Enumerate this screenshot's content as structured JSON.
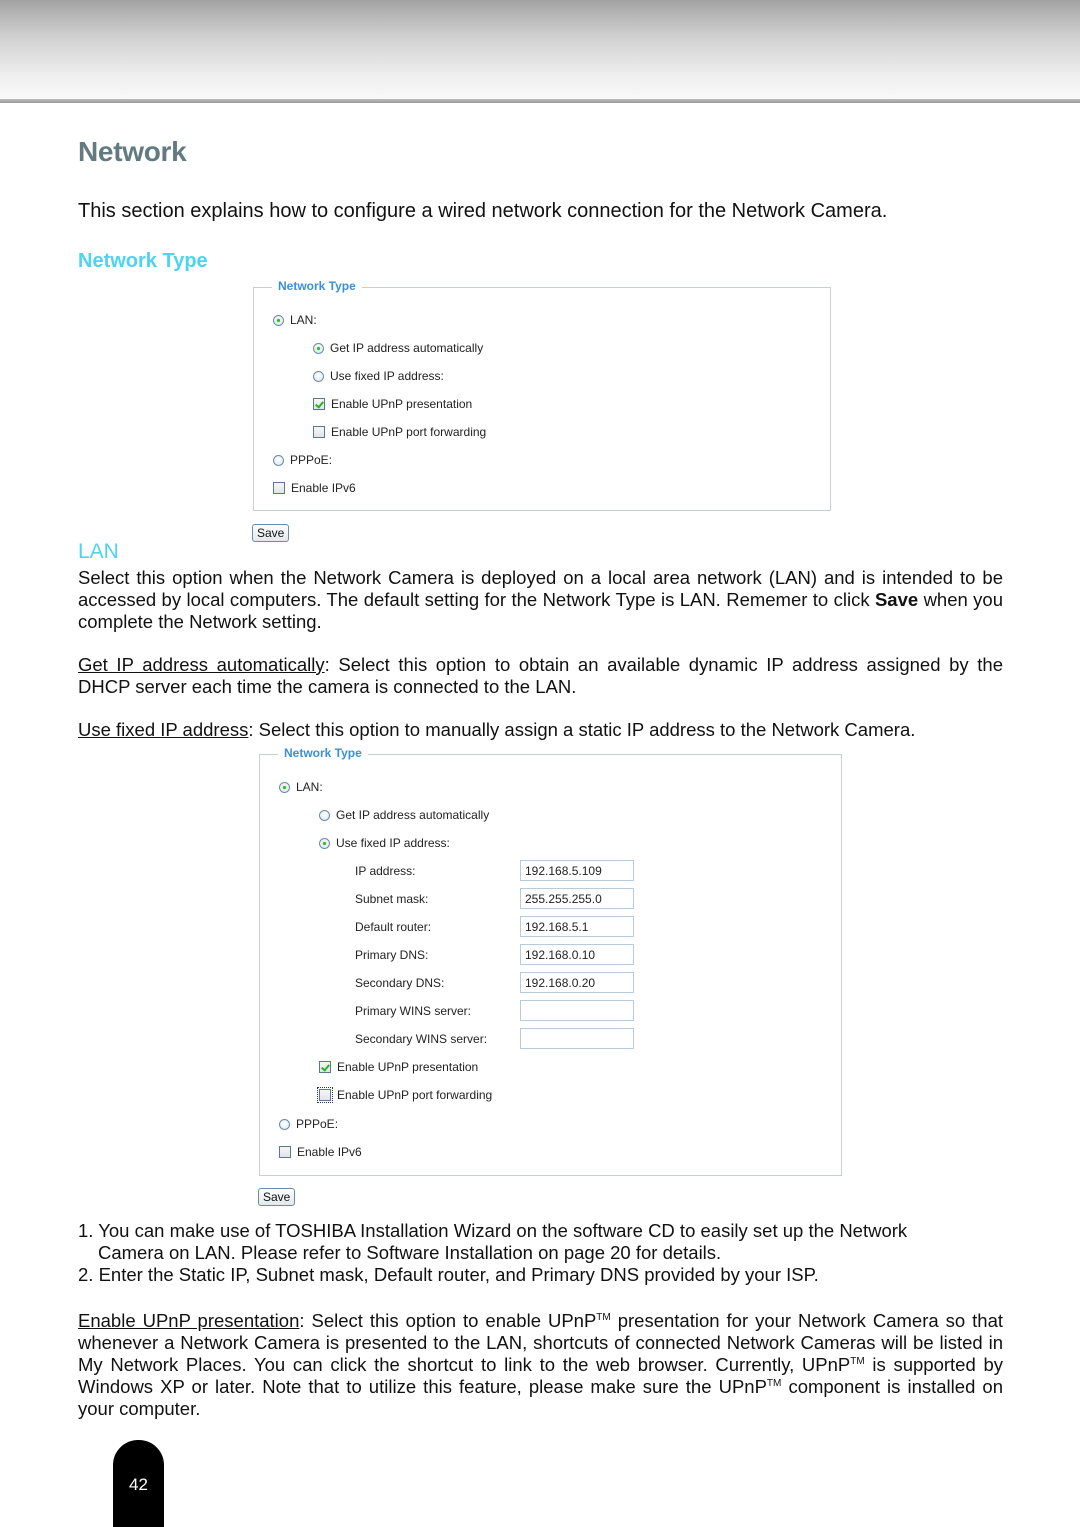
{
  "page": {
    "title": "Network",
    "intro": "This section explains how to configure a wired network connection for the Network Camera.",
    "subheading": "Network Type",
    "lan_heading": "LAN",
    "page_number": "42"
  },
  "panel1": {
    "legend": "Network Type",
    "lan_label": "LAN:",
    "lan_selected": true,
    "get_ip_auto_label": "Get IP address automatically",
    "get_ip_auto_selected": true,
    "use_fixed_ip_label": "Use fixed IP address:",
    "use_fixed_ip_selected": false,
    "upnp_presentation_label": "Enable UPnP presentation",
    "upnp_presentation_checked": true,
    "upnp_port_forwarding_label": "Enable UPnP port forwarding",
    "upnp_port_forwarding_checked": false,
    "pppoe_label": "PPPoE:",
    "pppoe_selected": false,
    "ipv6_label": "Enable IPv6",
    "ipv6_checked": false,
    "save_label": "Save"
  },
  "lan_section": {
    "para1_a": "Select this option when the Network Camera is deployed on a local area network (LAN) and is intended to be accessed by local computers. The default setting for the Network Type is LAN. Rememer to click ",
    "para1_bold": "Save",
    "para1_b": " when you complete the Network setting.",
    "get_ip_term": "Get IP address automatically",
    "get_ip_desc": ": Select this option to obtain an available dynamic IP address assigned by the DHCP server each time the camera is connected to the LAN.",
    "fixed_ip_term": "Use fixed IP address",
    "fixed_ip_desc": ": Select this option to manually assign a static IP address to the Network Camera."
  },
  "panel2": {
    "legend": "Network Type",
    "lan_label": "LAN:",
    "lan_selected": true,
    "get_ip_auto_label": "Get IP address automatically",
    "get_ip_auto_selected": false,
    "use_fixed_ip_label": "Use fixed IP address:",
    "use_fixed_ip_selected": true,
    "fields": [
      {
        "label": "IP address:",
        "value": "192.168.5.109"
      },
      {
        "label": "Subnet mask:",
        "value": "255.255.255.0"
      },
      {
        "label": "Default router:",
        "value": "192.168.5.1"
      },
      {
        "label": "Primary DNS:",
        "value": "192.168.0.10"
      },
      {
        "label": "Secondary DNS:",
        "value": "192.168.0.20"
      },
      {
        "label": "Primary WINS server:",
        "value": ""
      },
      {
        "label": "Secondary WINS server:",
        "value": ""
      }
    ],
    "upnp_presentation_label": "Enable UPnP presentation",
    "upnp_presentation_checked": true,
    "upnp_port_forwarding_label": "Enable UPnP port forwarding",
    "upnp_port_forwarding_checked": false,
    "pppoe_label": "PPPoE:",
    "pppoe_selected": false,
    "ipv6_label": "Enable IPv6",
    "ipv6_checked": false,
    "save_label": "Save"
  },
  "notes": [
    {
      "num": "1.",
      "text_line1": "You can make use of TOSHIBA Installation Wizard on the software CD to easily set up the Network",
      "text_line2": "Camera on LAN. Please refer to Software Installation on page 20 for details."
    },
    {
      "num": "2.",
      "text_line1": "Enter the Static IP, Subnet mask, Default router, and Primary DNS provided by your ISP."
    }
  ],
  "upnp_section": {
    "term": "Enable UPnP presentation",
    "t1": ": Select this option to enable UPnP",
    "tm": "TM",
    "t2": " presentation for your Network Camera so that whenever a Network Camera is presented to the LAN, shortcuts of connected Network Cameras will be listed in My Network Places. You can click the shortcut to link to the web browser. Currently, UPnP",
    "t3": " is supported by Windows XP or later. Note that to utilize this feature, please make sure the UPnP",
    "t4": " component is installed on your computer."
  },
  "colors": {
    "title": "#627a80",
    "subheading": "#4dd4f0",
    "legend": "#3a8fd9"
  }
}
